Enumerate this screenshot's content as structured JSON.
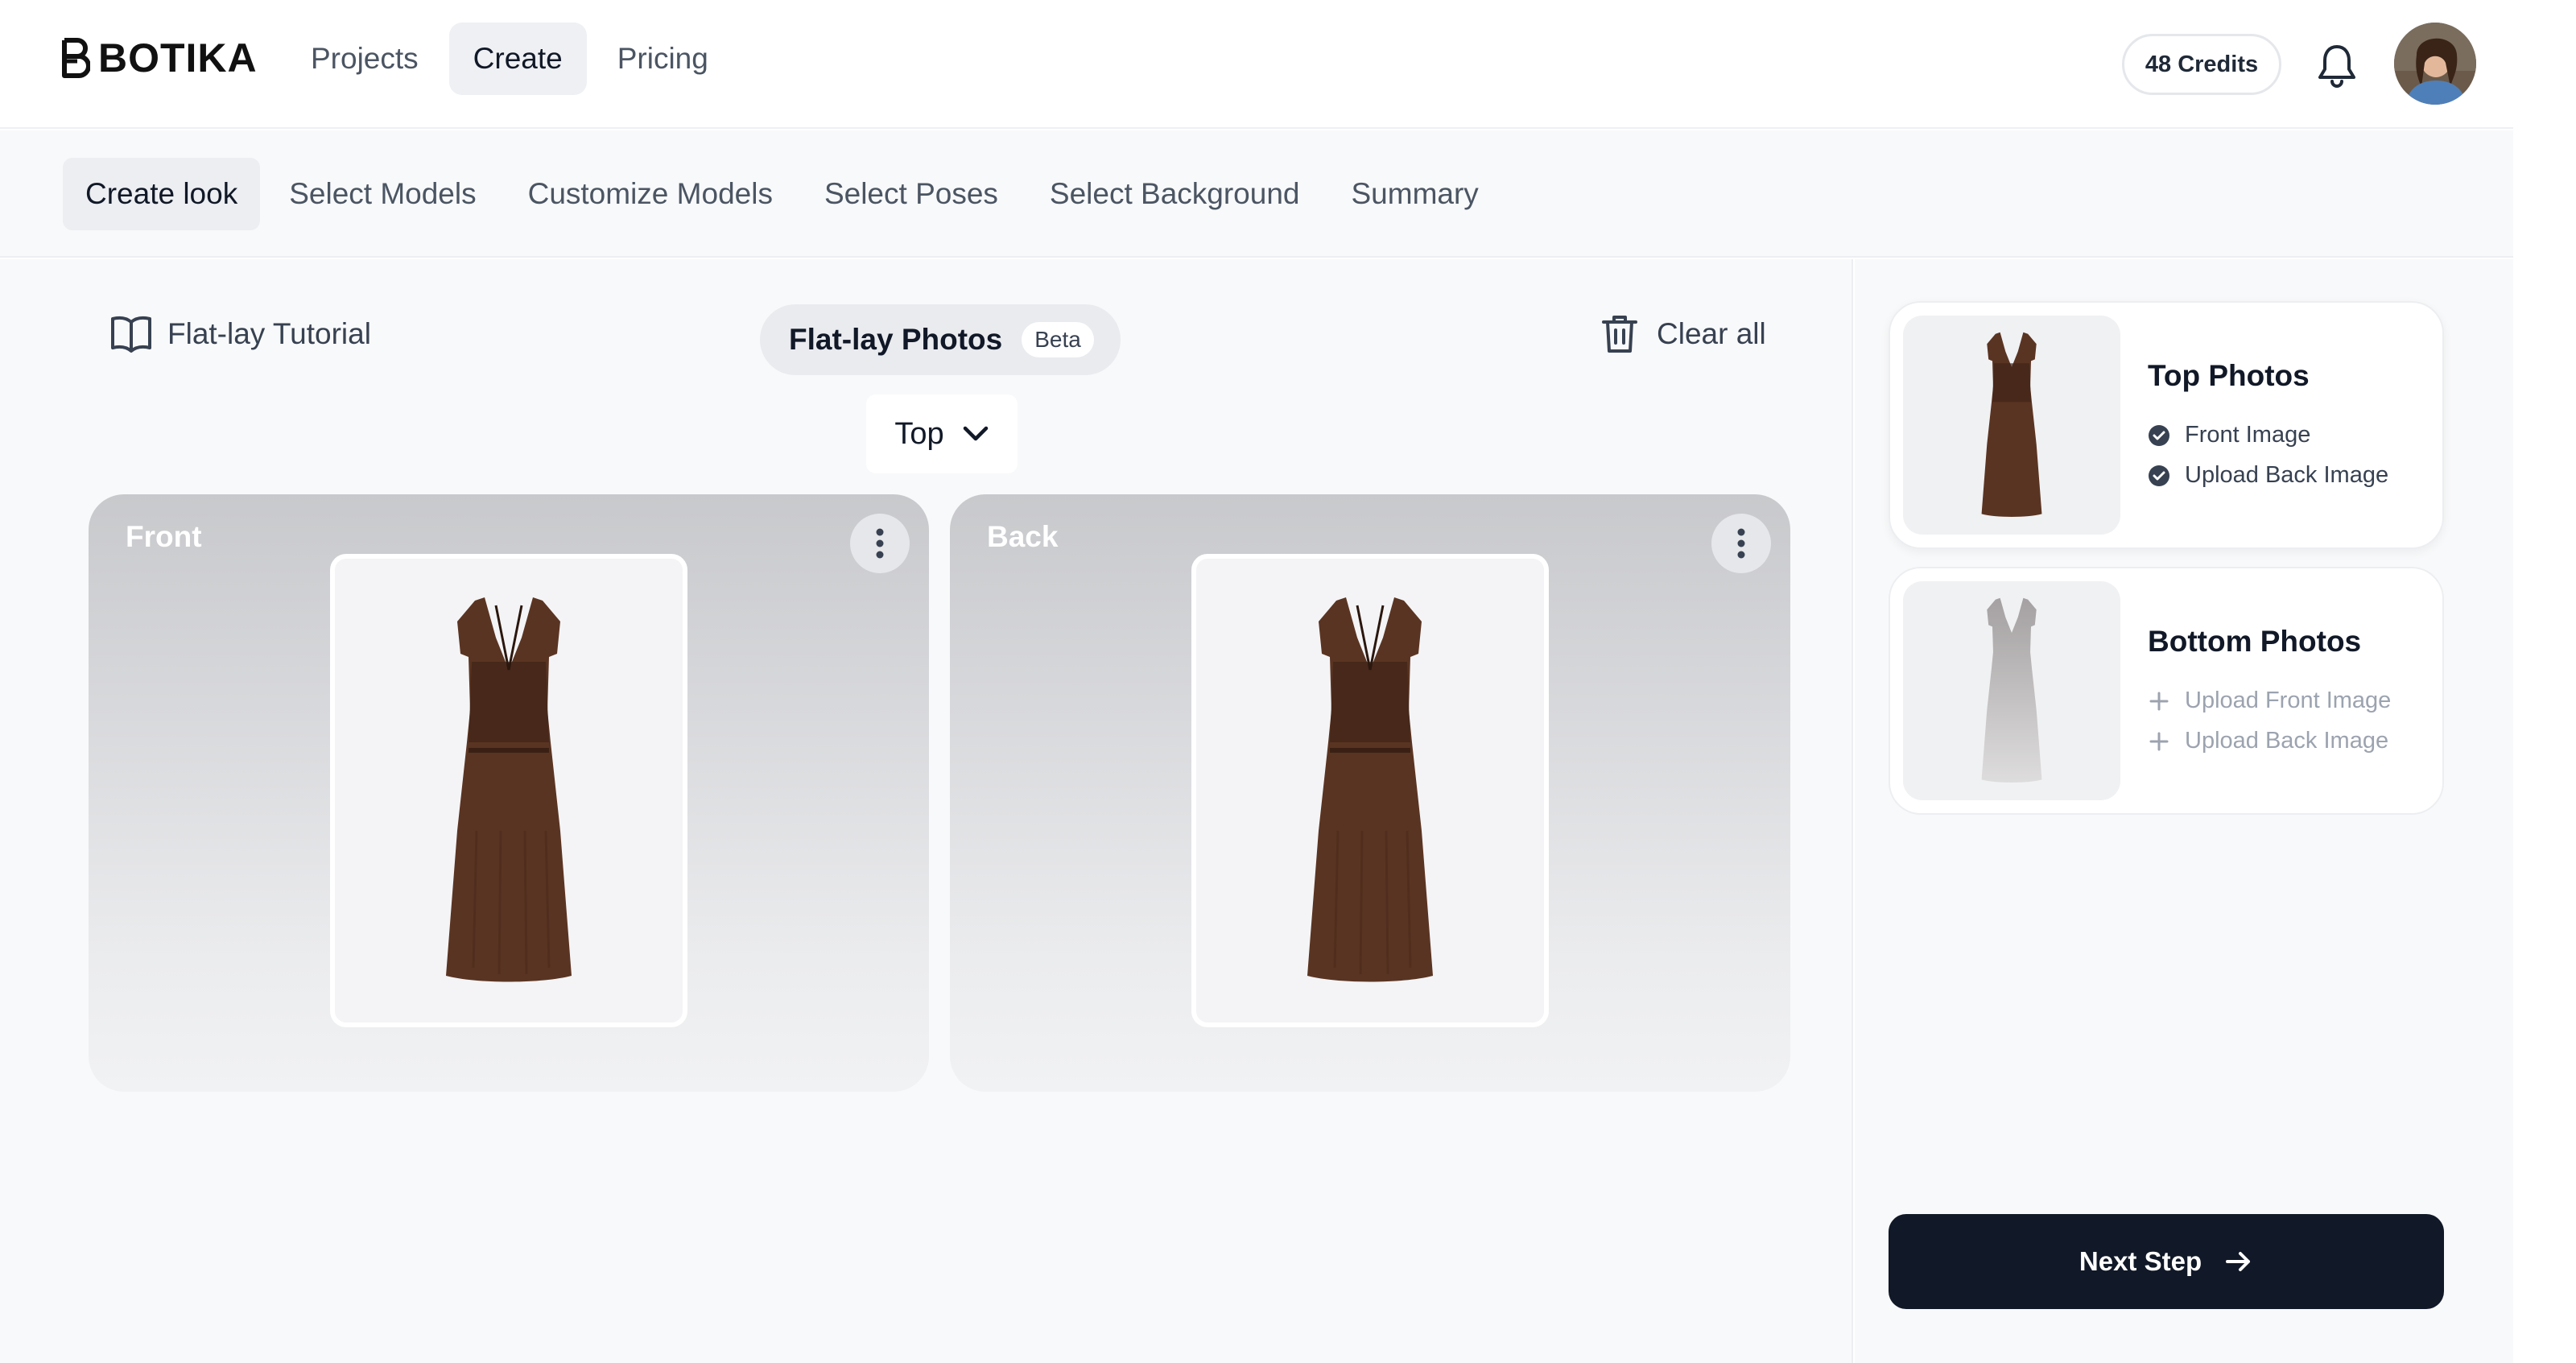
{
  "brand": {
    "name": "BOTIKA"
  },
  "nav": {
    "items": [
      {
        "label": "Projects",
        "active": false
      },
      {
        "label": "Create",
        "active": true
      },
      {
        "label": "Pricing",
        "active": false
      }
    ]
  },
  "account": {
    "credits_label": "48 Credits"
  },
  "steps": [
    {
      "label": "Create look",
      "active": true
    },
    {
      "label": "Select Models",
      "active": false
    },
    {
      "label": "Customize Models",
      "active": false
    },
    {
      "label": "Select Poses",
      "active": false
    },
    {
      "label": "Select Background",
      "active": false
    },
    {
      "label": "Summary",
      "active": false
    }
  ],
  "toolbar": {
    "tutorial_label": "Flat-lay Tutorial",
    "flatlay_title": "Flat-lay Photos",
    "beta_badge": "Beta",
    "clear_all_label": "Clear all"
  },
  "garment_select": {
    "selected": "Top"
  },
  "panels": {
    "front": {
      "label": "Front"
    },
    "back": {
      "label": "Back"
    }
  },
  "sidebar": {
    "top_card": {
      "title": "Top Photos",
      "items": [
        {
          "label": "Front Image",
          "status": "done"
        },
        {
          "label": "Upload Back Image",
          "status": "done"
        }
      ]
    },
    "bottom_card": {
      "title": "Bottom Photos",
      "items": [
        {
          "label": "Upload Front Image",
          "status": "pending"
        },
        {
          "label": "Upload Back Image",
          "status": "pending"
        }
      ]
    },
    "next_button_label": "Next Step"
  },
  "colors": {
    "accent_dark": "#111827",
    "dress": "#5a3422",
    "panel_gray": "#c8c9cc"
  }
}
